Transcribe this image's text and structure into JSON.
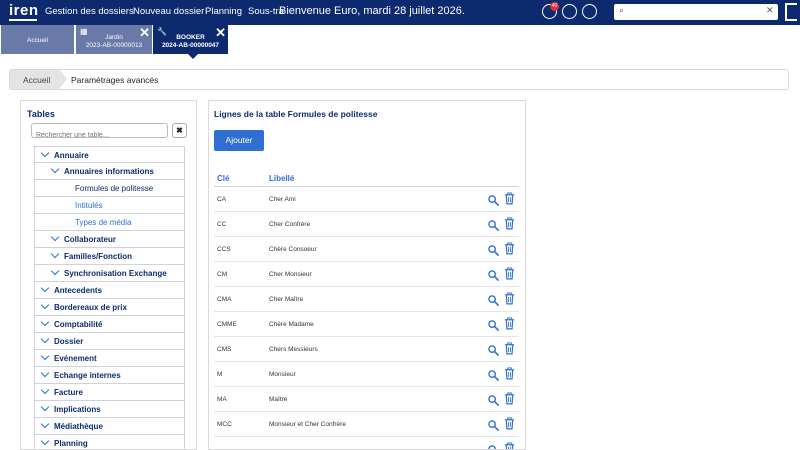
{
  "header": {
    "logo": "iren",
    "nav": [
      "Gestion des dossiers",
      "Nouveau dossier",
      "Planning",
      "Sous-tra"
    ],
    "welcome": "Bienvenue Euro, mardi 28 juillet 2026.",
    "notification_count": "40",
    "search_placeholder": "",
    "icons": [
      "alert-icon",
      "bell-icon",
      "globe-icon",
      "search-icon",
      "close-icon",
      "logout-icon"
    ]
  },
  "tabs": [
    {
      "line1": "Accueil",
      "line2": ""
    },
    {
      "line1": "Jardin",
      "line2": "2023-AB-00000013"
    },
    {
      "line1": "BOOKER",
      "line2": "2024-AB-00000047"
    }
  ],
  "breadcrumb": {
    "home": "Accueil",
    "current": "Paramétrages avancés"
  },
  "tables_panel": {
    "title": "Tables",
    "search_placeholder": "Rechercher une table...",
    "clear_label": "✖",
    "tree": [
      {
        "label": "Annuaire",
        "level": 1
      },
      {
        "label": "Annuaires informations",
        "level": 2
      },
      {
        "label": "Formules de politesse",
        "level": 3,
        "active": true
      },
      {
        "label": "Intitulés",
        "level": 3
      },
      {
        "label": "Types de média",
        "level": 3
      },
      {
        "label": "Collaborateur",
        "level": 2
      },
      {
        "label": "Familles/Fonction",
        "level": 2
      },
      {
        "label": "Synchronisation Exchange",
        "level": 2
      },
      {
        "label": "Antecedents",
        "level": 1
      },
      {
        "label": "Bordereaux de prix",
        "level": 1
      },
      {
        "label": "Comptabilité",
        "level": 1
      },
      {
        "label": "Dossier",
        "level": 1
      },
      {
        "label": "Evénement",
        "level": 1
      },
      {
        "label": "Echange internes",
        "level": 1
      },
      {
        "label": "Facture",
        "level": 1
      },
      {
        "label": "Implications",
        "level": 1
      },
      {
        "label": "Médiathèque",
        "level": 1
      },
      {
        "label": "Planning",
        "level": 1
      }
    ]
  },
  "lines_panel": {
    "title": "Lignes de la table Formules de politesse",
    "add_button": "Ajouter",
    "columns": {
      "key": "Clé",
      "label": "Libellé"
    },
    "rows": [
      {
        "key": "CA",
        "label": "Cher Ami"
      },
      {
        "key": "CC",
        "label": "Cher Confrère"
      },
      {
        "key": "CCS",
        "label": "Chère Consoeur"
      },
      {
        "key": "CM",
        "label": "Cher Monsieur"
      },
      {
        "key": "CMA",
        "label": "Cher Maître"
      },
      {
        "key": "CMME",
        "label": "Chère Madame"
      },
      {
        "key": "CMS",
        "label": "Chers Messieurs"
      },
      {
        "key": "M",
        "label": "Monsieur"
      },
      {
        "key": "MA",
        "label": "Maître"
      },
      {
        "key": "MCC",
        "label": "Monsieur et Cher Confrère"
      },
      {
        "key": "",
        "label": ""
      }
    ]
  },
  "colors": {
    "navy": "#0d2a6e",
    "blue": "#2f6fd1",
    "tab_inactive": "#6a7aa8"
  }
}
